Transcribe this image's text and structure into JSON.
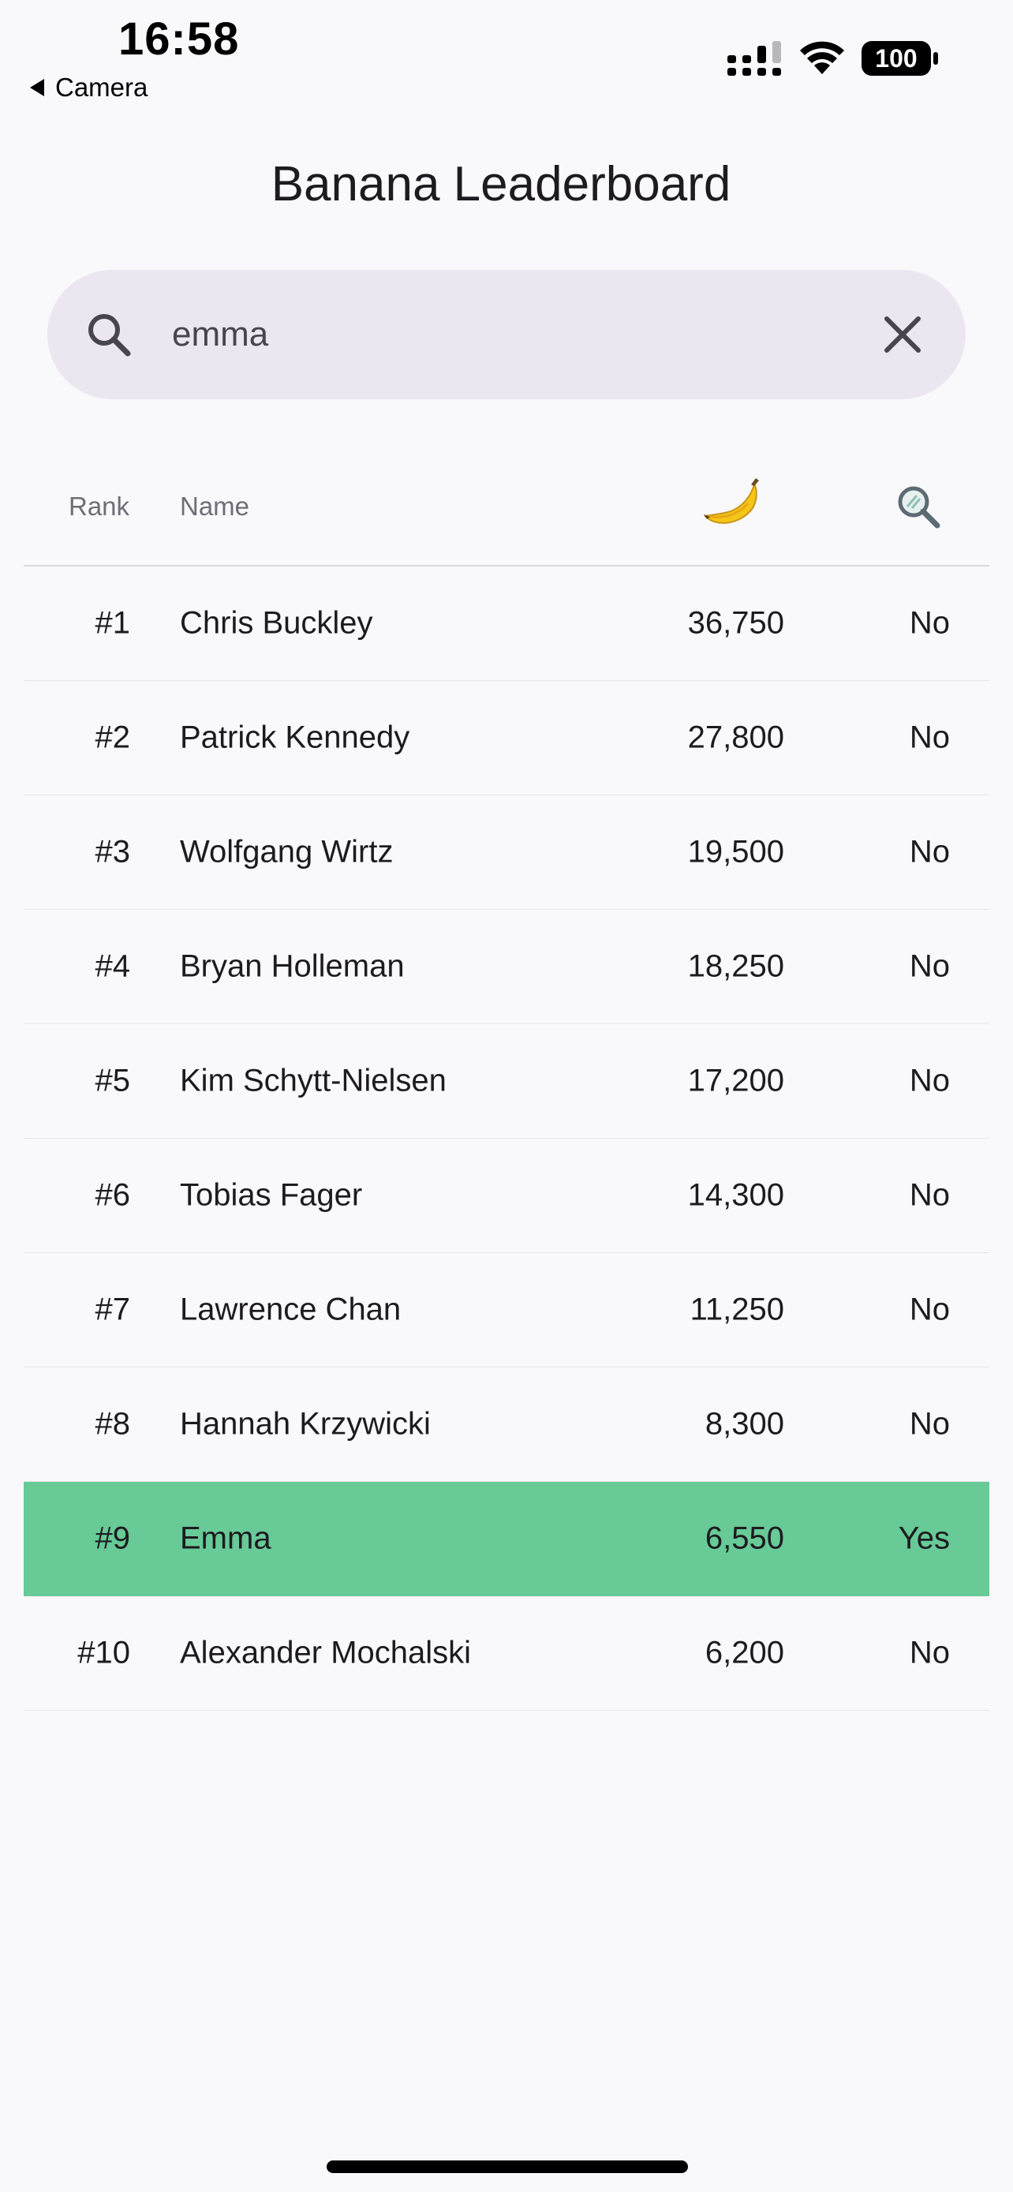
{
  "status_bar": {
    "time": "16:58",
    "back_label": "Camera",
    "battery": "100"
  },
  "page": {
    "title": "Banana Leaderboard"
  },
  "search": {
    "value": "emma"
  },
  "table": {
    "headers": {
      "rank": "Rank",
      "name": "Name",
      "bananas_icon": "banana-icon",
      "found_icon": "search-icon"
    },
    "highlight_color": "#67ca97",
    "rows": [
      {
        "rank": "#1",
        "name": "Chris Buckley",
        "bananas": "36,750",
        "found": "No"
      },
      {
        "rank": "#2",
        "name": "Patrick Kennedy",
        "bananas": "27,800",
        "found": "No"
      },
      {
        "rank": "#3",
        "name": "Wolfgang Wirtz",
        "bananas": "19,500",
        "found": "No"
      },
      {
        "rank": "#4",
        "name": "Bryan Holleman",
        "bananas": "18,250",
        "found": "No"
      },
      {
        "rank": "#5",
        "name": "Kim Schytt-Nielsen",
        "bananas": "17,200",
        "found": "No"
      },
      {
        "rank": "#6",
        "name": "Tobias Fager",
        "bananas": "14,300",
        "found": "No"
      },
      {
        "rank": "#7",
        "name": "Lawrence Chan",
        "bananas": "11,250",
        "found": "No"
      },
      {
        "rank": "#8",
        "name": "Hannah Krzywicki",
        "bananas": "8,300",
        "found": "No"
      },
      {
        "rank": "#9",
        "name": "Emma",
        "bananas": "6,550",
        "found": "Yes",
        "highlighted": true
      },
      {
        "rank": "#10",
        "name": "Alexander Mochalski",
        "bananas": "6,200",
        "found": "No"
      }
    ]
  }
}
